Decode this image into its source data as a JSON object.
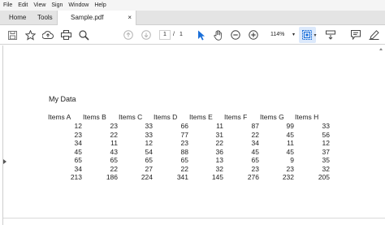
{
  "menu": [
    "File",
    "Edit",
    "View",
    "Sign",
    "Window",
    "Help"
  ],
  "tabs": {
    "home": "Home",
    "tools": "Tools",
    "document": "Sample.pdf",
    "close": "×"
  },
  "toolbar": {
    "page_current": "1",
    "page_sep": "/",
    "page_total": "1",
    "zoom": "114%",
    "icons": [
      "save-icon",
      "bookmark-star-icon",
      "upload-icon",
      "print-icon",
      "find-icon",
      "page-up-icon",
      "page-down-icon",
      "select-arrow-icon",
      "hand-icon",
      "zoom-out-icon",
      "zoom-in-icon",
      "marquee-select-icon",
      "scroll-mode-icon",
      "comment-icon",
      "sign-icon"
    ],
    "accent_color": "#1a6fd9"
  },
  "document": {
    "title": "My Data",
    "columns": [
      "Items A",
      "Items B",
      "Items C",
      "Items D",
      "Items E",
      "Items F",
      "Items G",
      "Items H"
    ],
    "rows": [
      [
        "12",
        "23",
        "33",
        "66",
        "11",
        "87",
        "99",
        "33"
      ],
      [
        "23",
        "22",
        "33",
        "77",
        "31",
        "22",
        "45",
        "56"
      ],
      [
        "34",
        "11",
        "12",
        "23",
        "22",
        "34",
        "11",
        "12"
      ],
      [
        "45",
        "43",
        "54",
        "88",
        "36",
        "45",
        "45",
        "37"
      ],
      [
        "65",
        "65",
        "65",
        "65",
        "13",
        "65",
        "9",
        "35"
      ],
      [
        "34",
        "22",
        "27",
        "22",
        "32",
        "23",
        "23",
        "32"
      ],
      [
        "213",
        "186",
        "224",
        "341",
        "145",
        "276",
        "232",
        "205"
      ]
    ]
  }
}
